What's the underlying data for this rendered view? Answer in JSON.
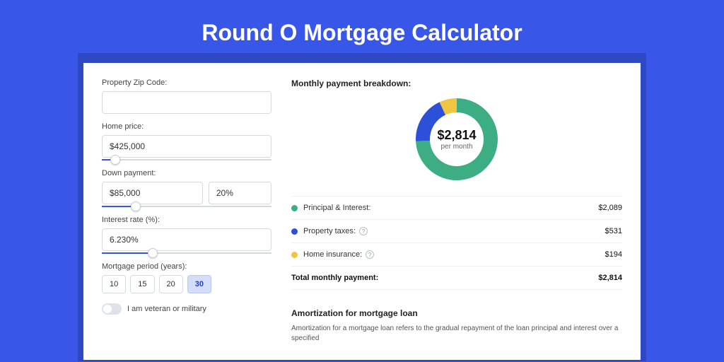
{
  "title": "Round O Mortgage Calculator",
  "form": {
    "zip_label": "Property Zip Code:",
    "zip_value": "",
    "price_label": "Home price:",
    "price_value": "$425,000",
    "price_fill": 8,
    "down_label": "Down payment:",
    "down_value": "$85,000",
    "down_pct": "20%",
    "down_fill": 20,
    "rate_label": "Interest rate (%):",
    "rate_value": "6.230%",
    "rate_fill": 30,
    "period_label": "Mortgage period (years):",
    "periods": [
      "10",
      "15",
      "20",
      "30"
    ],
    "period_active": 3,
    "vet_label": "I am veteran or military"
  },
  "breakdown": {
    "heading": "Monthly payment breakdown:",
    "center_amount": "$2,814",
    "center_sub": "per month",
    "rows": [
      {
        "label": "Principal & Interest:",
        "value": "$2,089",
        "color": "#3dae84",
        "info": false
      },
      {
        "label": "Property taxes:",
        "value": "$531",
        "color": "#2d50d8",
        "info": true
      },
      {
        "label": "Home insurance:",
        "value": "$194",
        "color": "#f0c542",
        "info": true
      }
    ],
    "total_label": "Total monthly payment:",
    "total_value": "$2,814"
  },
  "amort": {
    "title": "Amortization for mortgage loan",
    "body": "Amortization for a mortgage loan refers to the gradual repayment of the loan principal and interest over a specified"
  },
  "chart_data": {
    "type": "pie",
    "title": "Monthly payment breakdown",
    "series": [
      {
        "name": "Principal & Interest",
        "value": 2089,
        "color": "#3dae84"
      },
      {
        "name": "Property taxes",
        "value": 531,
        "color": "#2d50d8"
      },
      {
        "name": "Home insurance",
        "value": 194,
        "color": "#f0c542"
      }
    ],
    "total": 2814,
    "center_label": "$2,814 per month"
  }
}
